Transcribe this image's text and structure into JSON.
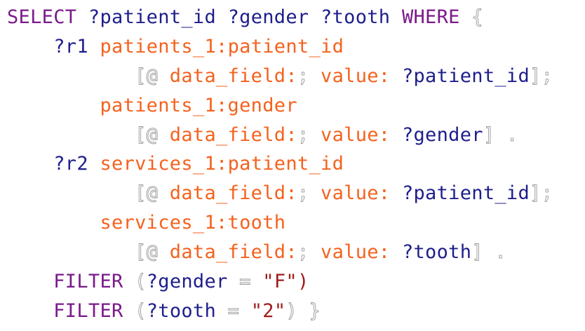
{
  "editor": {
    "lines": [
      [
        {
          "t": "SELECT",
          "c": "kw"
        },
        {
          "t": " ",
          "c": ""
        },
        {
          "t": "?patient_id",
          "c": "var"
        },
        {
          "t": " ",
          "c": ""
        },
        {
          "t": "?gender",
          "c": "var"
        },
        {
          "t": " ",
          "c": ""
        },
        {
          "t": "?tooth",
          "c": "var"
        },
        {
          "t": " ",
          "c": ""
        },
        {
          "t": "WHERE",
          "c": "kw"
        },
        {
          "t": " ",
          "c": ""
        },
        {
          "t": "{",
          "c": "ghost"
        }
      ],
      [
        {
          "t": "    ",
          "c": ""
        },
        {
          "t": "?r1",
          "c": "var"
        },
        {
          "t": " ",
          "c": ""
        },
        {
          "t": "patients_1:patient_id",
          "c": "pred"
        }
      ],
      [
        {
          "t": "           ",
          "c": ""
        },
        {
          "t": "[",
          "c": "ghost"
        },
        {
          "t": "@",
          "c": "ghost"
        },
        {
          "t": " ",
          "c": ""
        },
        {
          "t": "data_field:",
          "c": "pred"
        },
        {
          "t": ";",
          "c": "ghost"
        },
        {
          "t": " ",
          "c": ""
        },
        {
          "t": "value:",
          "c": "pred"
        },
        {
          "t": " ",
          "c": ""
        },
        {
          "t": "?patient_id",
          "c": "var"
        },
        {
          "t": "]",
          "c": "ghost"
        },
        {
          "t": ";",
          "c": "ghost"
        }
      ],
      [
        {
          "t": "        ",
          "c": ""
        },
        {
          "t": "patients_1:gender",
          "c": "pred"
        }
      ],
      [
        {
          "t": "           ",
          "c": ""
        },
        {
          "t": "[",
          "c": "ghost"
        },
        {
          "t": "@",
          "c": "ghost"
        },
        {
          "t": " ",
          "c": ""
        },
        {
          "t": "data_field:",
          "c": "pred"
        },
        {
          "t": ";",
          "c": "ghost"
        },
        {
          "t": " ",
          "c": ""
        },
        {
          "t": "value:",
          "c": "pred"
        },
        {
          "t": " ",
          "c": ""
        },
        {
          "t": "?gender",
          "c": "var"
        },
        {
          "t": "]",
          "c": "ghost"
        },
        {
          "t": " ",
          "c": ""
        },
        {
          "t": ".",
          "c": "ghost"
        }
      ],
      [
        {
          "t": "    ",
          "c": ""
        },
        {
          "t": "?r2",
          "c": "var"
        },
        {
          "t": " ",
          "c": ""
        },
        {
          "t": "services_1:patient_id",
          "c": "pred"
        }
      ],
      [
        {
          "t": "           ",
          "c": ""
        },
        {
          "t": "[",
          "c": "ghost"
        },
        {
          "t": "@",
          "c": "ghost"
        },
        {
          "t": " ",
          "c": ""
        },
        {
          "t": "data_field:",
          "c": "pred"
        },
        {
          "t": ";",
          "c": "ghost"
        },
        {
          "t": " ",
          "c": ""
        },
        {
          "t": "value:",
          "c": "pred"
        },
        {
          "t": " ",
          "c": ""
        },
        {
          "t": "?patient_id",
          "c": "var"
        },
        {
          "t": "]",
          "c": "ghost"
        },
        {
          "t": ";",
          "c": "ghost"
        }
      ],
      [
        {
          "t": "        ",
          "c": ""
        },
        {
          "t": "services_1:tooth",
          "c": "pred"
        }
      ],
      [
        {
          "t": "           ",
          "c": ""
        },
        {
          "t": "[",
          "c": "ghost"
        },
        {
          "t": "@",
          "c": "ghost"
        },
        {
          "t": " ",
          "c": ""
        },
        {
          "t": "data_field:",
          "c": "pred"
        },
        {
          "t": ";",
          "c": "ghost"
        },
        {
          "t": " ",
          "c": ""
        },
        {
          "t": "value:",
          "c": "pred"
        },
        {
          "t": " ",
          "c": ""
        },
        {
          "t": "?tooth",
          "c": "var"
        },
        {
          "t": "]",
          "c": "ghost"
        },
        {
          "t": " ",
          "c": ""
        },
        {
          "t": ".",
          "c": "ghost"
        }
      ],
      [
        {
          "t": "    ",
          "c": ""
        },
        {
          "t": "FILTER",
          "c": "kw"
        },
        {
          "t": " ",
          "c": ""
        },
        {
          "t": "(",
          "c": "ghost"
        },
        {
          "t": "?gender",
          "c": "var"
        },
        {
          "t": " ",
          "c": ""
        },
        {
          "t": "=",
          "c": "ghost"
        },
        {
          "t": " ",
          "c": ""
        },
        {
          "t": "\"F\"",
          "c": "str"
        },
        {
          "t": ")",
          "c": "str"
        }
      ],
      [
        {
          "t": "    ",
          "c": ""
        },
        {
          "t": "FILTER",
          "c": "kw"
        },
        {
          "t": " ",
          "c": ""
        },
        {
          "t": "(",
          "c": "ghost"
        },
        {
          "t": "?tooth",
          "c": "var"
        },
        {
          "t": " ",
          "c": ""
        },
        {
          "t": "=",
          "c": "ghost"
        },
        {
          "t": " ",
          "c": ""
        },
        {
          "t": "\"2\"",
          "c": "str"
        },
        {
          "t": ")",
          "c": "ghost"
        },
        {
          "t": " ",
          "c": ""
        },
        {
          "t": "}",
          "c": "ghost"
        }
      ]
    ],
    "colors": {
      "keyword": "#7a1a8a",
      "variable": "#1e1e8c",
      "predicate": "#f5621e",
      "string": "#a01c1c",
      "background": "#ffffff"
    }
  }
}
